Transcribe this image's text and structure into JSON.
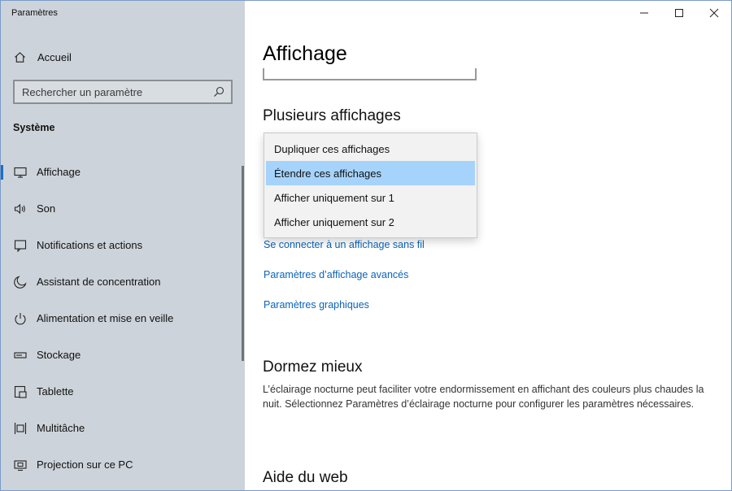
{
  "window": {
    "title": "Paramètres"
  },
  "sidebar": {
    "home_label": "Accueil",
    "search_placeholder": "Rechercher un paramètre",
    "section_title": "Système",
    "items": [
      {
        "label": "Affichage",
        "icon": "monitor-icon",
        "active": true
      },
      {
        "label": "Son",
        "icon": "speaker-icon"
      },
      {
        "label": "Notifications et actions",
        "icon": "notification-icon"
      },
      {
        "label": "Assistant de concentration",
        "icon": "moon-icon"
      },
      {
        "label": "Alimentation et mise en veille",
        "icon": "power-icon"
      },
      {
        "label": "Stockage",
        "icon": "storage-icon"
      },
      {
        "label": "Tablette",
        "icon": "tablet-icon"
      },
      {
        "label": "Multitâche",
        "icon": "multitask-icon"
      },
      {
        "label": "Projection sur ce PC",
        "icon": "projection-icon"
      }
    ]
  },
  "main": {
    "page_title": "Affichage",
    "multiple_displays_heading": "Plusieurs affichages",
    "dropdown": {
      "options": [
        "Dupliquer ces affichages",
        "Étendre ces affichages",
        "Afficher uniquement sur 1",
        "Afficher uniquement sur 2"
      ],
      "selected": "Étendre ces affichages"
    },
    "links": {
      "wireless": "Se connecter à un affichage sans fil",
      "advanced": "Paramètres d’affichage avancés",
      "graphics": "Paramètres graphiques"
    },
    "sleep_heading": "Dormez mieux",
    "sleep_text": "L’éclairage nocturne peut faciliter votre endormissement en affichant des couleurs plus chaudes la nuit. Sélectionnez Paramètres d’éclairage nocturne pour configurer les paramètres nécessaires.",
    "web_help_heading": "Aide du web"
  },
  "colors": {
    "accent": "#1a6fc4",
    "link": "#0b64b8",
    "sidebar_bg": "#cdd3da",
    "selection": "#a6d3fb"
  }
}
